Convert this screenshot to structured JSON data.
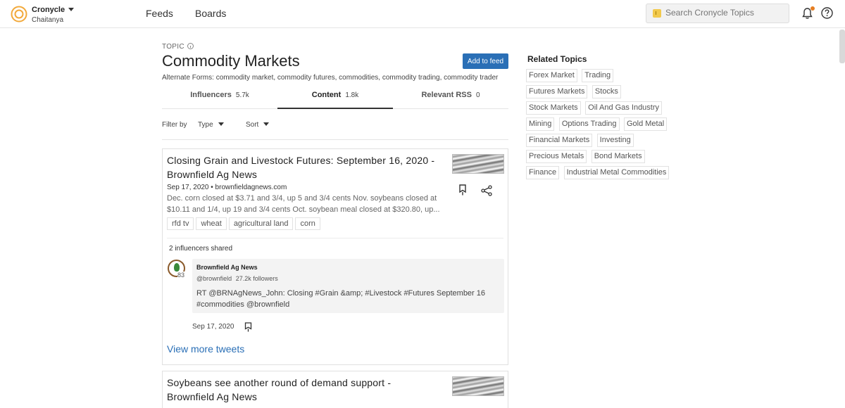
{
  "header": {
    "brand": "Cronycle",
    "user": "Chaitanya",
    "nav": [
      "Feeds",
      "Boards"
    ],
    "search_placeholder": "Search Cronycle Topics"
  },
  "topic": {
    "label": "TOPIC",
    "title": "Commodity Markets",
    "add_button": "Add to feed",
    "alternate_forms": "Alternate Forms: commodity market, commodity futures, commodities, commodity trading, commodity trader"
  },
  "tabs": [
    {
      "label": "Influencers",
      "count": "5.7k"
    },
    {
      "label": "Content",
      "count": "1.8k",
      "active": true
    },
    {
      "label": "Relevant RSS",
      "count": "0"
    }
  ],
  "filter": {
    "label": "Filter by",
    "type": "Type",
    "sort": "Sort"
  },
  "articles": [
    {
      "title": "Closing Grain and Livestock Futures: September 16, 2020 - Brownfield Ag News",
      "meta": "Sep 17, 2020 • brownfieldagnews.com",
      "snippet": "Dec. corn closed at $3.71 and 3/4, up 5 and 3/4 cents Nov. soybeans closed at $10.11 and 1/4, up 19 and 3/4 cents Oct. soybean meal closed at $320.80, up...",
      "tags": [
        "rfd tv",
        "wheat",
        "agricultural land",
        "corn"
      ],
      "influencers_shared": "2 influencers shared",
      "tweet": {
        "score": "83",
        "name": "Brownfield Ag News",
        "handle": "@brownfield",
        "followers": "27.2k followers",
        "text": "RT @BRNAgNews_John: Closing #Grain &amp; #Livestock #Futures September 16 #commodities @brownfield",
        "date": "Sep 17, 2020"
      },
      "view_more": "View more tweets"
    },
    {
      "title": "Soybeans see another round of demand support - Brownfield Ag News"
    }
  ],
  "related": {
    "title": "Related Topics",
    "topics": [
      "Forex Market",
      "Trading",
      "Futures Markets",
      "Stocks",
      "Stock Markets",
      "Oil And Gas Industry",
      "Mining",
      "Options Trading",
      "Gold Metal",
      "Financial Markets",
      "Investing",
      "Precious Metals",
      "Bond Markets",
      "Finance",
      "Industrial Metal Commodities"
    ]
  },
  "colors": {
    "accent": "#2a6fb6",
    "notification": "#e67e22"
  }
}
